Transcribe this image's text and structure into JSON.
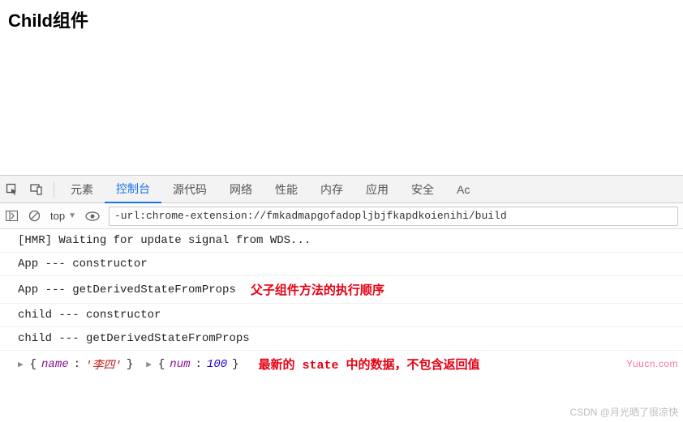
{
  "heading": "Child组件",
  "tabs": {
    "items": [
      "元素",
      "控制台",
      "源代码",
      "网络",
      "性能",
      "内存",
      "应用",
      "安全",
      "Ac"
    ],
    "activeIndex": 1
  },
  "toolbar": {
    "context": "top",
    "filter_value": "-url:chrome-extension://fmkadmapgofadopljbjfkapdkoienihi/build"
  },
  "console": {
    "lines": [
      "[HMR] Waiting for update signal from WDS...",
      "App --- constructor",
      "App --- getDerivedStateFromProps",
      "child --- constructor",
      "child --- getDerivedStateFromProps"
    ],
    "annotations": {
      "line2": "父子组件方法的执行顺序",
      "objline": "最新的 state 中的数据，不包含返回值"
    },
    "obj1": {
      "key": "name",
      "value": "'李四'"
    },
    "obj2": {
      "key": "num",
      "value": "100"
    }
  },
  "watermark1": "Yuucn.com",
  "watermark2": "CSDN @月光晒了很凉快"
}
